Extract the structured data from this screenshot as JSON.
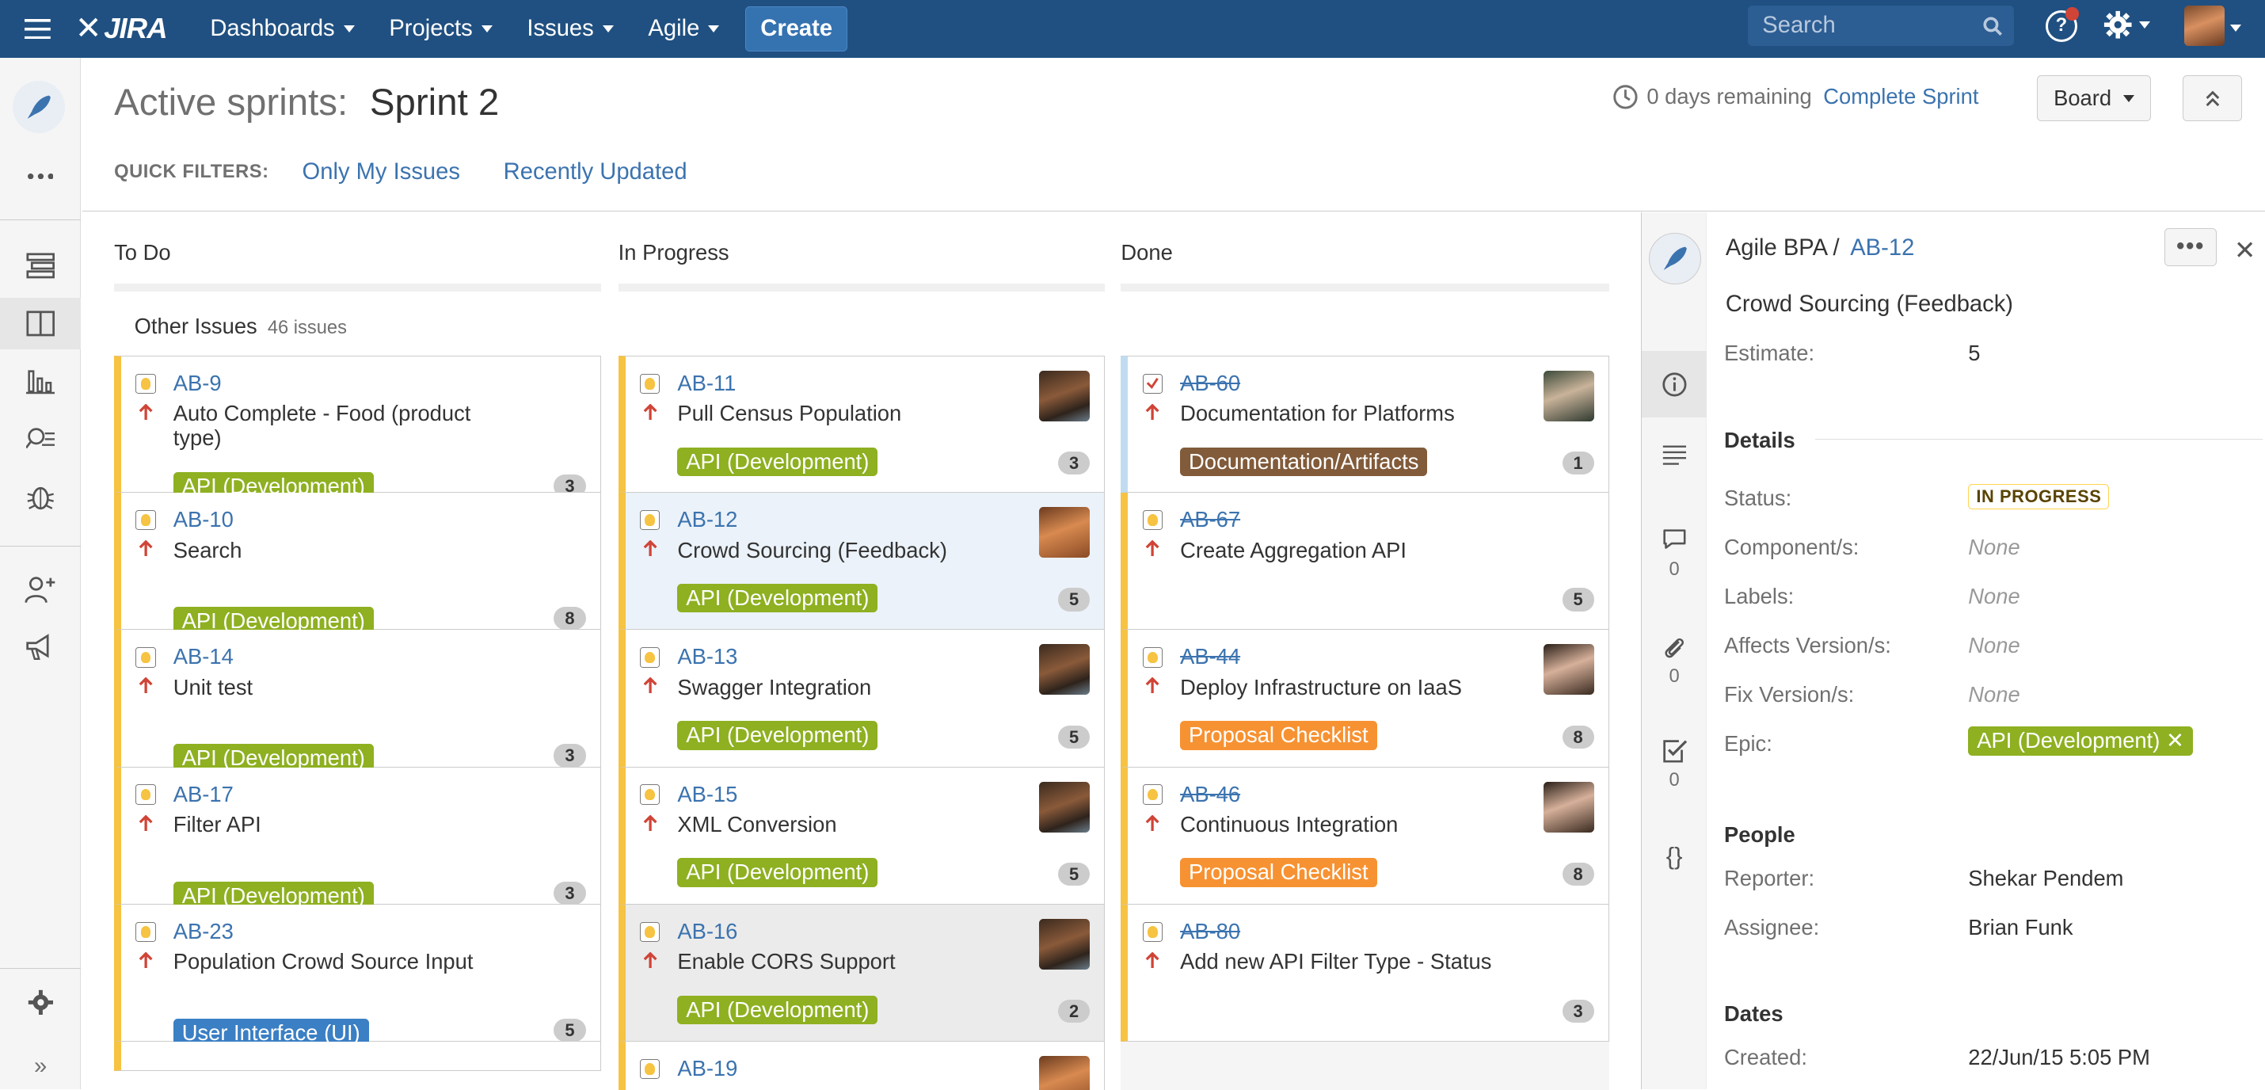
{
  "nav": {
    "logo": "JIRA",
    "items": [
      "Dashboards",
      "Projects",
      "Issues",
      "Agile"
    ],
    "create": "Create",
    "search_placeholder": "Search"
  },
  "header": {
    "title_label": "Active sprints:",
    "sprint_name": "Sprint 2",
    "remaining": "0 days remaining",
    "complete": "Complete Sprint",
    "board": "Board"
  },
  "quick_filters": {
    "label": "QUICK FILTERS:",
    "items": [
      "Only My Issues",
      "Recently Updated"
    ]
  },
  "columns": [
    "To Do",
    "In Progress",
    "Done"
  ],
  "swimlane": {
    "name": "Other Issues",
    "count": "46 issues"
  },
  "todo": [
    {
      "key": "AB-9",
      "summary": "Auto Complete - Food (product type)",
      "epic": "API (Development)",
      "est": "3"
    },
    {
      "key": "AB-10",
      "summary": "Search",
      "epic": "API (Development)",
      "est": "8"
    },
    {
      "key": "AB-14",
      "summary": "Unit test",
      "epic": "API (Development)",
      "est": "3"
    },
    {
      "key": "AB-17",
      "summary": "Filter API",
      "epic": "API (Development)",
      "est": "3"
    },
    {
      "key": "AB-23",
      "summary": "Population Crowd Source Input",
      "epic": "User Interface (UI)",
      "est": "5"
    }
  ],
  "inprogress": [
    {
      "key": "AB-11",
      "summary": "Pull Census Population",
      "epic": "API (Development)",
      "est": "3"
    },
    {
      "key": "AB-12",
      "summary": "Crowd Sourcing (Feedback)",
      "epic": "API (Development)",
      "est": "5"
    },
    {
      "key": "AB-13",
      "summary": "Swagger Integration",
      "epic": "API (Development)",
      "est": "5"
    },
    {
      "key": "AB-15",
      "summary": "XML Conversion",
      "epic": "API (Development)",
      "est": "5"
    },
    {
      "key": "AB-16",
      "summary": "Enable CORS Support",
      "epic": "API (Development)",
      "est": "2"
    },
    {
      "key": "AB-19"
    }
  ],
  "done": [
    {
      "key": "AB-60",
      "summary": "Documentation for Platforms",
      "epic": "Documentation/Artifacts",
      "est": "1"
    },
    {
      "key": "AB-67",
      "summary": "Create Aggregation API",
      "est": "5"
    },
    {
      "key": "AB-44",
      "summary": "Deploy Infrastructure on IaaS",
      "epic": "Proposal Checklist",
      "est": "8"
    },
    {
      "key": "AB-46",
      "summary": "Continuous Integration",
      "epic": "Proposal Checklist",
      "est": "8"
    },
    {
      "key": "AB-80",
      "summary": "Add new API Filter Type - Status",
      "est": "3"
    }
  ],
  "detail": {
    "project": "Agile BPA",
    "key": "AB-12",
    "title": "Crowd Sourcing (Feedback)",
    "estimate_label": "Estimate:",
    "estimate": "5",
    "details_heading": "Details",
    "fields": [
      {
        "label": "Status:",
        "value": "IN PROGRESS"
      },
      {
        "label": "Component/s:",
        "value": "None"
      },
      {
        "label": "Labels:",
        "value": "None"
      },
      {
        "label": "Affects Version/s:",
        "value": "None"
      },
      {
        "label": "Fix Version/s:",
        "value": "None"
      },
      {
        "label": "Epic:",
        "value": "API (Development)"
      }
    ],
    "people_heading": "People",
    "reporter_label": "Reporter:",
    "reporter": "Shekar Pendem",
    "assignee_label": "Assignee:",
    "assignee": "Brian Funk",
    "dates_heading": "Dates",
    "created_label": "Created:",
    "created": "22/Jun/15 5:05 PM",
    "tab_counts": {
      "comments": "0",
      "attachments": "0",
      "subtasks": "0"
    }
  },
  "colors": {
    "nav_bg": "#205081",
    "link": "#3b73af",
    "epic_green": "#8eb021",
    "epic_brown": "#815b3a",
    "epic_orange": "#f79232",
    "epic_blue": "#3b7fc4",
    "inprogress_flag": "#f6c342"
  }
}
